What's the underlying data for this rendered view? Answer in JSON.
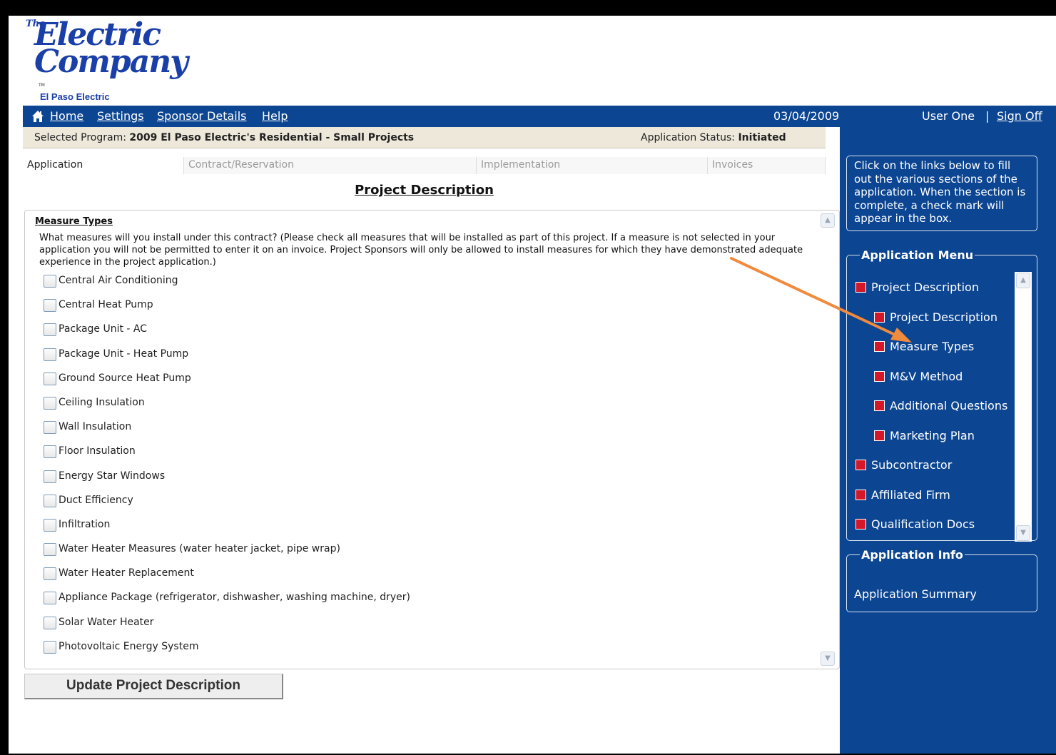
{
  "logo": {
    "the": "The",
    "line1": "Electric",
    "line2": "Company",
    "tm": "TM",
    "subtitle": "El Paso Electric"
  },
  "nav": {
    "home": "Home",
    "settings": "Settings",
    "sponsor_details": "Sponsor Details",
    "help": "Help",
    "date": "03/04/2009",
    "user": "User One",
    "separator": "|",
    "sign_off": "Sign Off"
  },
  "program": {
    "label": "Selected Program:",
    "name": "2009 El Paso Electric's Residential - Small Projects",
    "status_label": "Application Status:",
    "status_value": "Initiated"
  },
  "tabs": {
    "application": "Application",
    "contract": "Contract/Reservation",
    "implementation": "Implementation",
    "invoices": "Invoices"
  },
  "page_title": "Project Description",
  "measures": {
    "title": "Measure Types",
    "description": "What measures will you install under this contract? (Please check all measures that will be installed as part of this project. If a measure is not selected in your application you will not be permitted to enter it on an invoice. Project Sponsors will only be allowed to install measures for which they have demonstrated adequate experience in the project application.)",
    "items": [
      "Central Air Conditioning",
      "Central Heat Pump",
      "Package Unit - AC",
      "Package Unit - Heat Pump",
      "Ground Source Heat Pump",
      "Ceiling Insulation",
      "Wall Insulation",
      "Floor Insulation",
      "Energy Star Windows",
      "Duct Efficiency",
      "Infiltration",
      "Water Heater Measures (water heater jacket, pipe wrap)",
      "Water Heater Replacement",
      "Appliance Package (refrigerator, dishwasher, washing machine, dryer)",
      "Solar Water Heater",
      "Photovoltaic Energy System"
    ]
  },
  "update_button": "Update Project Description",
  "sidebar": {
    "help_text": "Click on the links below to fill out the various sections of the application. When the section is complete, a check mark will appear in the box.",
    "menu_title": "Application Menu",
    "menu_items": [
      {
        "label": "Project Description",
        "sub": false
      },
      {
        "label": "Project Description",
        "sub": true
      },
      {
        "label": "Measure Types",
        "sub": true
      },
      {
        "label": "M&V Method",
        "sub": true
      },
      {
        "label": "Additional Questions",
        "sub": true
      },
      {
        "label": "Marketing Plan",
        "sub": true
      },
      {
        "label": "Subcontractor",
        "sub": false
      },
      {
        "label": "Affiliated Firm",
        "sub": false
      },
      {
        "label": "Qualification Docs",
        "sub": false
      }
    ],
    "info_title": "Application Info",
    "info_link": "Application Summary"
  },
  "colors": {
    "nav_blue": "#0c4591",
    "status_red": "#d4182a",
    "annotation_arrow": "#f08a3c"
  },
  "icons": {
    "home": "house-icon",
    "scroll_up": "chevron-up-icon",
    "scroll_down": "chevron-down-icon"
  }
}
